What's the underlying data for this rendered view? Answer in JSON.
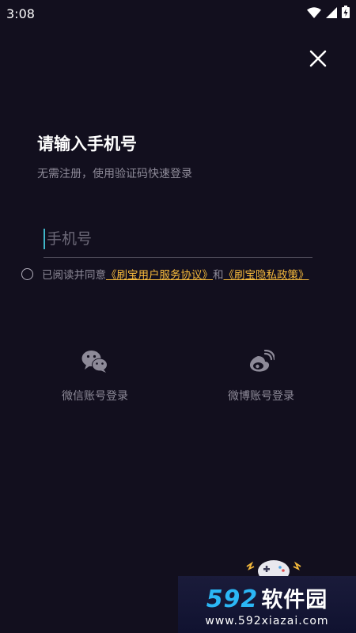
{
  "status_bar": {
    "time": "3:08",
    "icons": [
      "wifi-icon",
      "signal-icon",
      "battery-icon"
    ]
  },
  "close": {
    "icon": "close-icon"
  },
  "login": {
    "title": "请输入手机号",
    "subtitle": "无需注册，使用验证码快速登录",
    "phone_placeholder": "手机号",
    "phone_value": ""
  },
  "agreement": {
    "prefix": "已阅读并同意",
    "link_user": "《刷宝用户服务协议》",
    "conjunction": "和",
    "link_privacy": "《刷宝隐私政策》",
    "checked": false
  },
  "social": {
    "wechat": {
      "label": "微信账号登录",
      "icon": "wechat-icon"
    },
    "weibo": {
      "label": "微博账号登录",
      "icon": "weibo-icon"
    }
  },
  "watermark": {
    "number": "592",
    "text": "软件园",
    "url": "www.592xiazai.com"
  },
  "colors": {
    "background": "#120f1e",
    "accent_link": "#f5b93b",
    "caret": "#3fb6c8",
    "muted_text": "#8d8a98"
  }
}
